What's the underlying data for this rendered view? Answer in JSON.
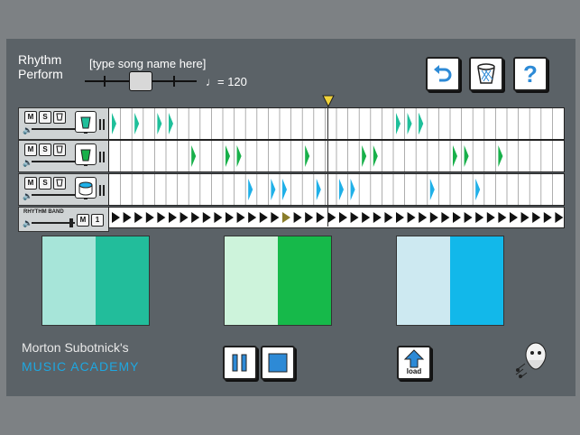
{
  "header": {
    "title_line1": "Rhythm",
    "title_line2": "Perform",
    "song_name_placeholder": "[type song name here]",
    "tempo_label": "♩= 120"
  },
  "toolbar": {
    "undo_icon": "undo-arrow-icon",
    "trash_icon": "trash-basket-icon",
    "help_label": "?"
  },
  "tracks": [
    {
      "mute": "M",
      "solo": "S",
      "icon": "cup-icon",
      "color": "#1fbf9a",
      "notes": [
        {
          "col": 0,
          "w": 1
        },
        {
          "col": 2,
          "w": 1
        },
        {
          "col": 4,
          "w": 2
        },
        {
          "col": 25,
          "w": 3
        },
        {
          "col": 27,
          "w": 1
        }
      ]
    },
    {
      "mute": "M",
      "solo": "S",
      "icon": "cup-icon",
      "color": "#18b04a",
      "notes": [
        {
          "col": 7,
          "w": 1
        },
        {
          "col": 10,
          "w": 2
        },
        {
          "col": 17,
          "w": 1
        },
        {
          "col": 22,
          "w": 2
        },
        {
          "col": 30,
          "w": 2
        },
        {
          "col": 34,
          "w": 1
        }
      ]
    },
    {
      "mute": "M",
      "solo": "S",
      "icon": "drum-icon",
      "color": "#1fb0e8",
      "notes": [
        {
          "col": 12,
          "w": 1
        },
        {
          "col": 14,
          "w": 2
        },
        {
          "col": 18,
          "w": 1
        },
        {
          "col": 20,
          "w": 2
        },
        {
          "col": 28,
          "w": 1
        },
        {
          "col": 32,
          "w": 1
        }
      ]
    }
  ],
  "rhythm_band": {
    "label": "RHYTHM BAND",
    "mute": "M",
    "value": "1"
  },
  "panels": [
    {
      "left_color": "#a7e5d9",
      "right_color": "#22bd9b"
    },
    {
      "left_color": "#cdf3db",
      "right_color": "#16b94a"
    },
    {
      "left_color": "#cde9f1",
      "right_color": "#12b8ea"
    }
  ],
  "footer": {
    "brand_line1": "Morton Subotnick's",
    "brand_line2": "MUSIC ACADEMY",
    "brand_color": "#1ea7e0",
    "load_label": "load"
  },
  "playhead_col": 15
}
